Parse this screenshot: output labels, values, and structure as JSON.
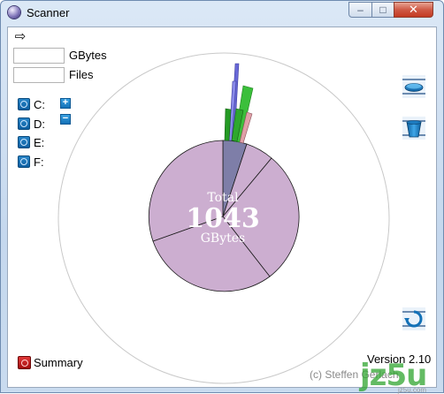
{
  "window": {
    "title": "Scanner",
    "minimize": "–",
    "maximize": "□",
    "close": "✕"
  },
  "toolbar": {
    "forward_glyph": "⇨"
  },
  "stats": {
    "size_value": "",
    "size_unit": "GBytes",
    "files_value": "",
    "files_label": "Files"
  },
  "drives": [
    {
      "label": "C:"
    },
    {
      "label": "D:"
    },
    {
      "label": "E:"
    },
    {
      "label": "F:"
    }
  ],
  "zoom": {
    "plus": "+",
    "minus": "−"
  },
  "chart": {
    "total_label": "Total",
    "total_value": "1043",
    "unit": "GBytes",
    "colors": {
      "inner": "#ccaed0",
      "outline": "#1a1a1a",
      "outer_ring": "#ffffff",
      "dim_slice": "#7e7ea8",
      "bar_blue": "#6868d8",
      "bar_green": "#3bbf3b",
      "bar_dark_green": "#249a24",
      "bar_pink": "#e0a0a8"
    }
  },
  "summary": {
    "label": "Summary"
  },
  "footer": {
    "version": "Version 2.10",
    "copyright": "(c) Steffen Gerlach"
  },
  "watermark": {
    "text": "jz5u",
    "sub": "jz5u.com"
  }
}
